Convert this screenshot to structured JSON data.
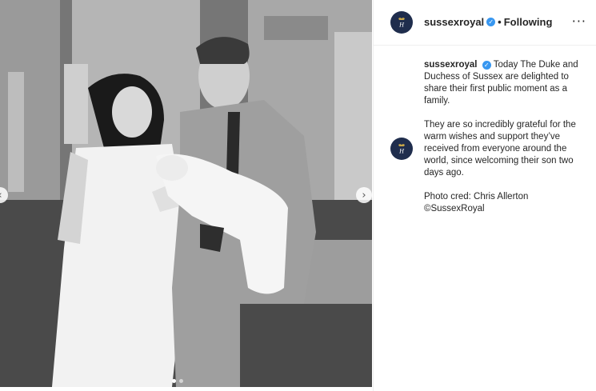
{
  "post": {
    "username": "sussexroyal",
    "separator": "•",
    "follow_status": "Following",
    "more_glyph": "···",
    "verified_glyph": "✓",
    "avatar_monogram": "H",
    "nav_prev_glyph": "‹",
    "nav_next_glyph": "›",
    "carousel": {
      "count": 2,
      "active_index": 0
    }
  },
  "caption": {
    "username": "sussexroyal",
    "paragraphs": [
      "Today The Duke and Duchess of Sussex are delighted to share their first public moment as a family.",
      "They are so incredibly grateful for the warm wishes and support they’ve received from everyone around the world, since welcoming their son two days ago.",
      "Photo cred: Chris Allerton\n©SussexRoyal"
    ]
  },
  "colors": {
    "verified": "#3897f0",
    "avatar_bg": "#1f2d4d",
    "text": "#262626",
    "border": "#efefef"
  },
  "icons": [
    "verified-badge-icon",
    "more-options-icon",
    "chevron-left-icon",
    "chevron-right-icon"
  ]
}
